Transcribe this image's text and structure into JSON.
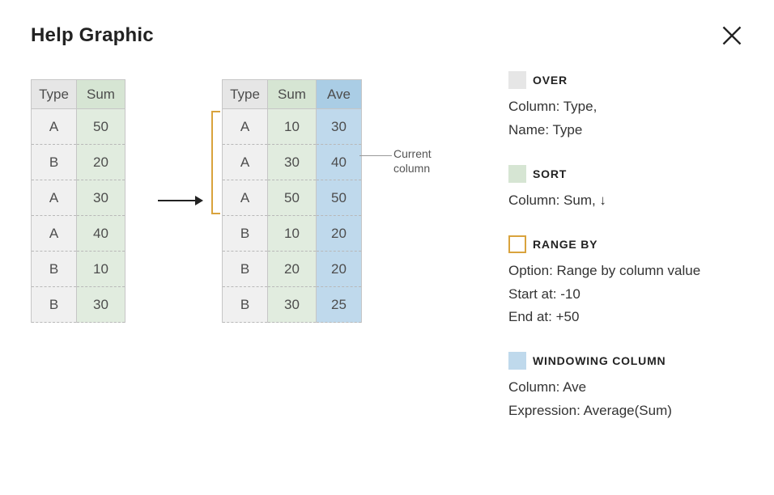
{
  "header": {
    "title": "Help Graphic"
  },
  "table_headers": {
    "type": "Type",
    "sum": "Sum",
    "ave": "Ave"
  },
  "table1": {
    "rows": [
      {
        "type": "A",
        "sum": "50"
      },
      {
        "type": "B",
        "sum": "20"
      },
      {
        "type": "A",
        "sum": "30"
      },
      {
        "type": "A",
        "sum": "40"
      },
      {
        "type": "B",
        "sum": "10"
      },
      {
        "type": "B",
        "sum": "30"
      }
    ]
  },
  "table2": {
    "rows": [
      {
        "type": "A",
        "sum": "10",
        "ave": "30"
      },
      {
        "type": "A",
        "sum": "30",
        "ave": "40"
      },
      {
        "type": "A",
        "sum": "50",
        "ave": "50"
      },
      {
        "type": "B",
        "sum": "10",
        "ave": "20"
      },
      {
        "type": "B",
        "sum": "20",
        "ave": "20"
      },
      {
        "type": "B",
        "sum": "30",
        "ave": "25"
      }
    ]
  },
  "annotation": {
    "current_column_l1": "Current",
    "current_column_l2": "column"
  },
  "legend": {
    "over": {
      "title": "OVER",
      "line1": "Column: Type,",
      "line2": "Name: Type"
    },
    "sort": {
      "title": "SORT",
      "line1": "Column: Sum, ↓"
    },
    "range": {
      "title": "RANGE BY",
      "line1": "Option: Range by column value",
      "line2": "Start at: -10",
      "line3": "End at: +50"
    },
    "win": {
      "title": "WINDOWING COLUMN",
      "line1": "Column: Ave",
      "line2": "Expression: Average(Sum)"
    }
  }
}
